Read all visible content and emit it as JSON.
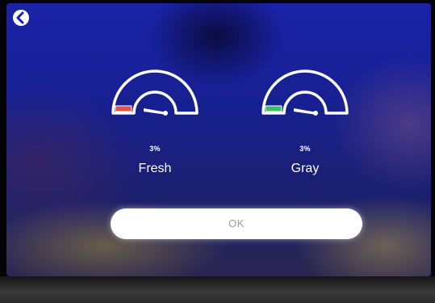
{
  "tanks": [
    {
      "name": "Fresh",
      "percent_label": "3%",
      "level_fraction": 0.03,
      "indicator_color": "#e05050"
    },
    {
      "name": "Gray",
      "percent_label": "3%",
      "level_fraction": 0.03,
      "indicator_color": "#3bbf6a"
    }
  ],
  "ok_button": {
    "label": "OK"
  },
  "colors": {
    "screen_background": "#1a22a8",
    "gauge_outline": "#ffffff",
    "button_background": "#ffffff",
    "button_text": "#9a9aa8"
  },
  "icons": {
    "back": "back-chevron-circle-icon"
  }
}
